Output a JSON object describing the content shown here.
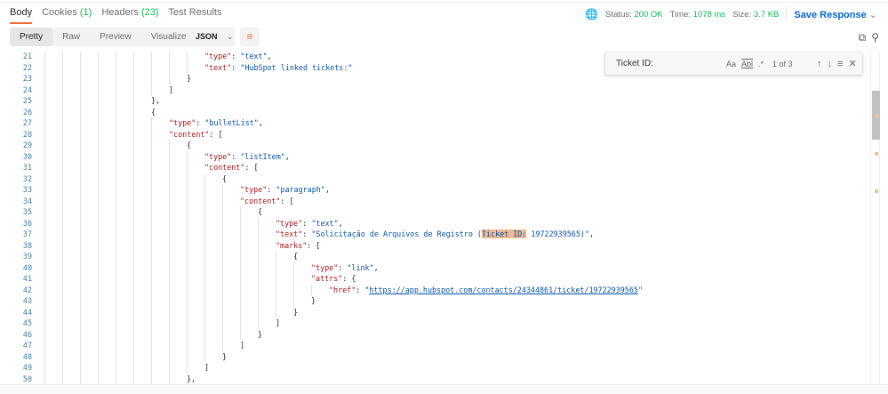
{
  "tabs": [
    {
      "label": "Body",
      "count": ""
    },
    {
      "label": "Cookies",
      "count": "(1)"
    },
    {
      "label": "Headers",
      "count": "(23)"
    },
    {
      "label": "Test Results",
      "count": ""
    }
  ],
  "meta": {
    "status_label": "Status:",
    "status": "200 OK",
    "time_label": "Time:",
    "time": "1078 ms",
    "size_label": "Size:",
    "size": "3.7 KB",
    "save": "Save Response"
  },
  "views": [
    "Pretty",
    "Raw",
    "Preview",
    "Visualize"
  ],
  "format": "JSON",
  "find": {
    "value": "Ticket ID:",
    "count": "1 of 3",
    "case": "Aa",
    "word": "Abl",
    "regex": ".*"
  },
  "lines": [
    {
      "n": 21,
      "l": 9,
      "k": "\"type\"",
      "s": "\"text\"",
      "p": ","
    },
    {
      "n": 22,
      "l": 9,
      "k": "\"text\"",
      "s": "\"HubSpot linked tickets:\"",
      "p": ""
    },
    {
      "n": 23,
      "l": 8,
      "p": "}"
    },
    {
      "n": 24,
      "l": 7,
      "p": "]"
    },
    {
      "n": 25,
      "l": 6,
      "p": "},"
    },
    {
      "n": 26,
      "l": 6,
      "p": "{"
    },
    {
      "n": 27,
      "l": 7,
      "k": "\"type\"",
      "s": "\"bulletList\"",
      "p": ","
    },
    {
      "n": 28,
      "l": 7,
      "k": "\"content\"",
      "p": "["
    },
    {
      "n": 29,
      "l": 8,
      "p": "{"
    },
    {
      "n": 30,
      "l": 9,
      "k": "\"type\"",
      "s": "\"listItem\"",
      "p": ","
    },
    {
      "n": 31,
      "l": 9,
      "k": "\"content\"",
      "p": "["
    },
    {
      "n": 32,
      "l": 10,
      "p": "{"
    },
    {
      "n": 33,
      "l": 11,
      "k": "\"type\"",
      "s": "\"paragraph\"",
      "p": ","
    },
    {
      "n": 34,
      "l": 11,
      "k": "\"content\"",
      "p": "["
    },
    {
      "n": 35,
      "l": 12,
      "p": "{"
    },
    {
      "n": 36,
      "l": 13,
      "k": "\"type\"",
      "s": "\"text\"",
      "p": ","
    },
    {
      "n": 37,
      "l": 13,
      "k": "\"text\"",
      "s": "\"Solicitação de Arquivos de Registro (",
      "h": "Ticket ID:",
      "s2": " 19722939565)\"",
      "p": ","
    },
    {
      "n": 38,
      "l": 13,
      "k": "\"marks\"",
      "p": "["
    },
    {
      "n": 39,
      "l": 14,
      "p": "{"
    },
    {
      "n": 40,
      "l": 15,
      "k": "\"type\"",
      "s": "\"link\"",
      "p": ","
    },
    {
      "n": 41,
      "l": 15,
      "k": "\"attrs\"",
      "p": "{"
    },
    {
      "n": 42,
      "l": 16,
      "k": "\"href\"",
      "s": "\"",
      "u": "https://app.hubspot.com/contacts/24344861/ticket/19722939565",
      "s2": "\"",
      "p": ""
    },
    {
      "n": 43,
      "l": 15,
      "p": "}"
    },
    {
      "n": 44,
      "l": 14,
      "p": "}"
    },
    {
      "n": 45,
      "l": 13,
      "p": "]"
    },
    {
      "n": 46,
      "l": 12,
      "p": "}"
    },
    {
      "n": 47,
      "l": 11,
      "p": "]"
    },
    {
      "n": 48,
      "l": 10,
      "p": "}"
    },
    {
      "n": 49,
      "l": 9,
      "p": "]"
    },
    {
      "n": 50,
      "l": 8,
      "p": "},"
    }
  ]
}
